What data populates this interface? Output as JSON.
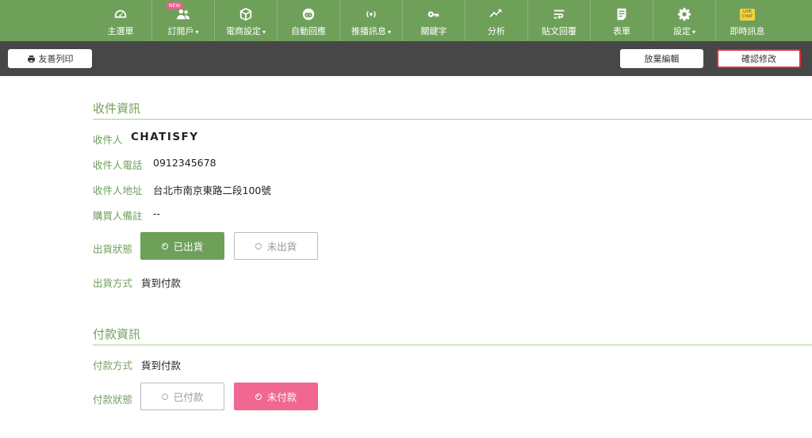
{
  "nav": {
    "items": [
      {
        "label": "主選單",
        "icon": "dashboard-icon",
        "caret": ""
      },
      {
        "label": "訂閱戶",
        "icon": "subscribers-icon",
        "caret": "▾",
        "badge": "NEW"
      },
      {
        "label": "電商設定",
        "icon": "box-icon",
        "caret": "▾"
      },
      {
        "label": "自動回應",
        "icon": "bot-icon",
        "caret": ""
      },
      {
        "label": "推播訊息",
        "icon": "broadcast-icon",
        "caret": "▾"
      },
      {
        "label": "關鍵字",
        "icon": "key-icon",
        "caret": ""
      },
      {
        "label": "分析",
        "icon": "chart-icon",
        "caret": ""
      },
      {
        "label": "貼文回覆",
        "icon": "reply-icon",
        "caret": ""
      },
      {
        "label": "表單",
        "icon": "form-icon",
        "caret": ""
      },
      {
        "label": "設定",
        "icon": "gear-icon",
        "caret": "▾"
      },
      {
        "label": "即時訊息",
        "icon": "live-chat-icon",
        "caret": "",
        "badge_lines": [
          "LIVE",
          "CHAT"
        ]
      }
    ]
  },
  "toolbar": {
    "print_label": "友善列印",
    "discard_label": "放棄編輯",
    "confirm_label": "確認修改"
  },
  "recipient": {
    "section_title": "收件資訊",
    "name_label": "收件人",
    "name_value": "CHATISFY",
    "phone_label": "收件人電話",
    "phone_value": "0912345678",
    "address_label": "收件人地址",
    "address_value": "台北市南京東路二段100號",
    "note_label": "購買人備註",
    "note_value": "--",
    "shipping_status_label": "出貨狀態",
    "shipped_label": "已出貨",
    "not_shipped_label": "未出貨",
    "shipping_method_label": "出貨方式",
    "shipping_method_value": "貨到付款"
  },
  "payment": {
    "section_title": "付款資訊",
    "method_label": "付款方式",
    "method_value": "貨到付款",
    "status_label": "付款狀態",
    "paid_label": "已付款",
    "unpaid_label": "未付款"
  },
  "colors": {
    "brand_green": "#6fa05a",
    "toolbar_dark": "#474747",
    "unpaid_pink": "#f06792",
    "highlight_red": "#e03030"
  }
}
